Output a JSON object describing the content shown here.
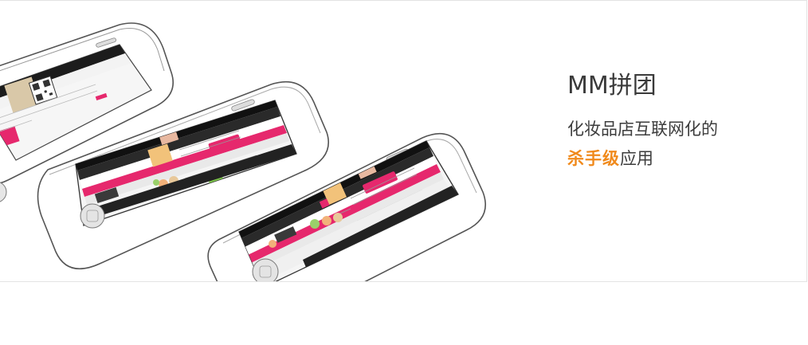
{
  "banner": {
    "title": "MM拼团",
    "tagline_line1": "化妆品店互联网化的",
    "tagline_highlight": "杀手级",
    "tagline_suffix": "应用"
  },
  "colors": {
    "accent": "#e6286d",
    "highlight": "#f08a1c",
    "phone_outline": "#555555",
    "screen_dark": "#1c1c1c",
    "button_green": "#7cc44a"
  },
  "icons": [
    "home-button-icon",
    "speaker-icon",
    "camera-icon",
    "qr-code-icon",
    "tab-bar-icon"
  ]
}
